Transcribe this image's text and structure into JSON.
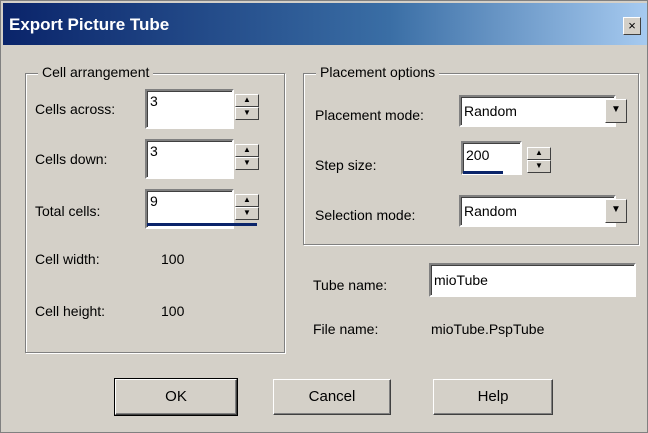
{
  "title": "Export Picture Tube",
  "close_glyph": "×",
  "cell_arrangement": {
    "group_label": "Cell arrangement",
    "cells_across_label": "Cells across:",
    "cells_across_value": "3",
    "cells_down_label": "Cells down:",
    "cells_down_value": "3",
    "total_cells_label": "Total cells:",
    "total_cells_value": "9",
    "cell_width_label": "Cell width:",
    "cell_width_value": "100",
    "cell_height_label": "Cell height:",
    "cell_height_value": "100"
  },
  "placement": {
    "group_label": "Placement options",
    "placement_mode_label": "Placement mode:",
    "placement_mode_value": "Random",
    "step_size_label": "Step size:",
    "step_size_value": "200",
    "selection_mode_label": "Selection mode:",
    "selection_mode_value": "Random"
  },
  "tube": {
    "tube_name_label": "Tube name:",
    "tube_name_value": "mioTube",
    "file_name_label": "File name:",
    "file_name_value": "mioTube.PspTube"
  },
  "buttons": {
    "ok": "OK",
    "cancel": "Cancel",
    "help": "Help"
  },
  "icons": {
    "spin_up": "▲",
    "spin_down": "▼",
    "dropdown": "▼"
  }
}
